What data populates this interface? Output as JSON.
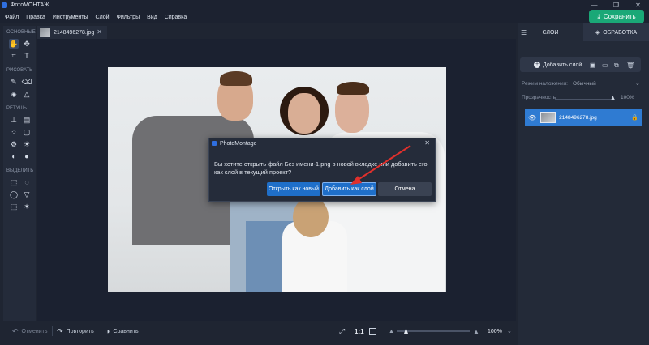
{
  "app": {
    "title": "ФотоМОНТАЖ"
  },
  "window_controls": {
    "minimize": "—",
    "maximize": "❐",
    "close": "✕"
  },
  "menu": [
    "Файл",
    "Правка",
    "Инструменты",
    "Слой",
    "Фильтры",
    "Вид",
    "Справка"
  ],
  "save_button": {
    "label": "Сохранить",
    "icon": "download-icon"
  },
  "toolbar": {
    "groups": [
      {
        "label": "ОСНОВНЫЕ"
      },
      {
        "label": "РИСОВАТЬ"
      },
      {
        "label": "РЕТУШЬ"
      },
      {
        "label": "ВЫДЕЛИТЬ"
      }
    ]
  },
  "document_tab": {
    "filename": "2148496278.jpg",
    "close": "✕"
  },
  "dialog": {
    "title": "PhotoMontage",
    "message": "Вы хотите открыть файл Без имени-1.png в новой вкладке или добавить его как слой в текущий проект?",
    "buttons": {
      "open_new": "Открыть как новый",
      "add_layer": "Добавить как слой",
      "cancel": "Отмена"
    },
    "close": "✕",
    "arrow_color": "#e0302c"
  },
  "bottom_bar": {
    "undo": "Отменить",
    "redo": "Повторить",
    "compare": "Сравнить",
    "zoom_one_to_one": "1:1",
    "zoom_level": "100%",
    "zoom_fraction": 0.1
  },
  "right_panel": {
    "tabs": {
      "layers": "СЛОИ",
      "processing": "ОБРАБОТКА"
    },
    "add_layer": "Добавить слой",
    "blend_mode_label": "Режим наложения:",
    "blend_mode_value": "Обычный",
    "opacity_label": "Прозрачность",
    "opacity_value": "100%",
    "layers": [
      {
        "name": "2148496278.jpg"
      }
    ]
  },
  "colors": {
    "accent_green": "#1aa877",
    "accent_blue": "#1f6fc9",
    "layer_selected": "#2f7bd2"
  }
}
